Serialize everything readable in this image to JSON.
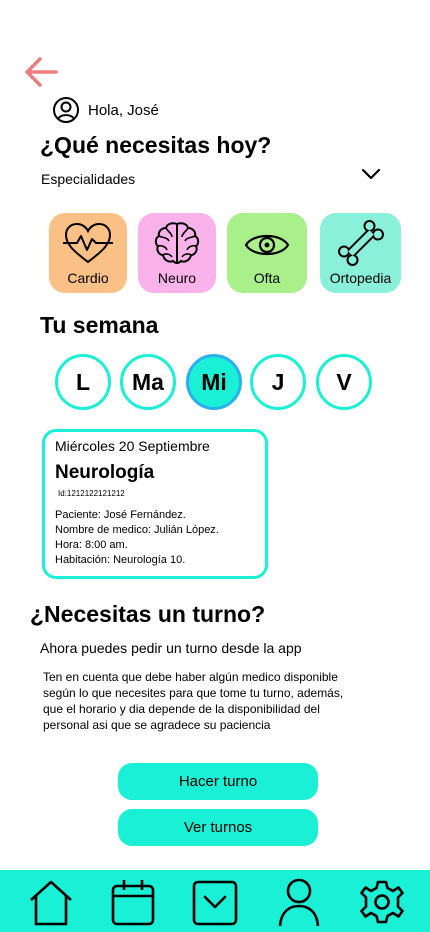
{
  "header": {
    "greeting": "Hola, José"
  },
  "main": {
    "title": "¿Qué necesitas hoy?",
    "specialties_label": "Especialidades",
    "categories": [
      {
        "label": "Cardio",
        "color": "#fbc085",
        "icon": "heart-pulse-icon"
      },
      {
        "label": "Neuro",
        "color": "#f9b2ea",
        "icon": "brain-icon"
      },
      {
        "label": "Ofta",
        "color": "#aaf08a",
        "icon": "eye-icon"
      },
      {
        "label": "Ortopedia",
        "color": "#8bf0d9",
        "icon": "bone-icon"
      }
    ]
  },
  "week": {
    "title": "Tu semana",
    "days": [
      "L",
      "Ma",
      "Mi",
      "J",
      "V"
    ],
    "active_day": "Mi"
  },
  "appointment": {
    "date": "Miércoles 20 Septiembre",
    "specialty": "Neurología",
    "id": "Id:1212122121212",
    "patient": "Paciente: José Fernández.",
    "doctor": "Nombre de medico: Julián López.",
    "time": "Hora: 8:00 am.",
    "room": "Habitación: Neurología 10."
  },
  "turn": {
    "title": "¿Necesitas un turno?",
    "subtitle": "Ahora puedes pedir un turno desde la app",
    "description": "Ten en cuenta que debe haber algún medico disponible según lo que necesites para que tome tu turno, además, que el horario y dia depende de la disponibilidad del personal asi que se agradece su paciencia",
    "make_button": "Hacer turno",
    "view_button": "Ver turnos"
  },
  "nav": {
    "items": [
      "home-icon",
      "calendar-icon",
      "inbox-icon",
      "user-icon",
      "settings-icon"
    ]
  },
  "colors": {
    "accent": "#19f0d5",
    "back_arrow": "#f07d7d",
    "active_day_border": "#2ab0f0"
  }
}
